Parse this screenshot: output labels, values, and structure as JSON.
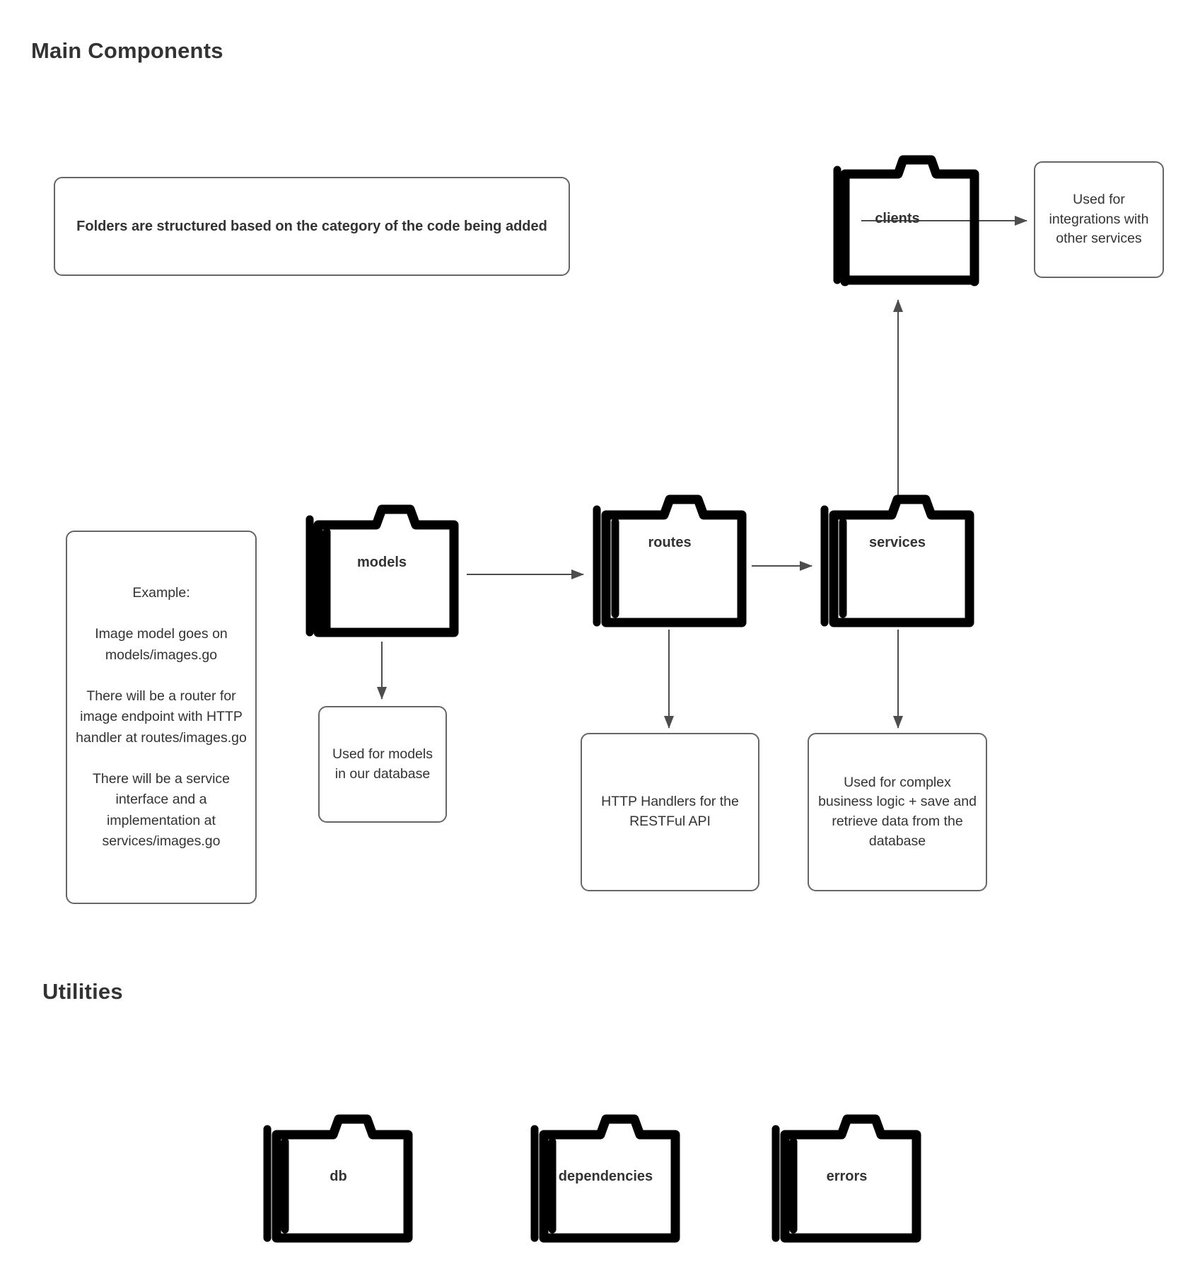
{
  "sections": {
    "main_title": "Main Components",
    "utilities_title": "Utilities"
  },
  "notes": {
    "folder_structure": "Folders are structured based on the category of the code being added",
    "clients_desc": "Used for integrations with other services",
    "example": "Example:\n\nImage model goes on models/images.go\n\nThere will be a router for image endpoint with HTTP handler at routes/images.go\n\nThere will be a service interface and a implementation at services/images.go",
    "models_desc": "Used for models in our database",
    "routes_desc": "HTTP Handlers for the RESTFul API",
    "services_desc": "Used for complex business logic + save and retrieve data from the database"
  },
  "folders": {
    "clients": "clients",
    "models": "models",
    "routes": "routes",
    "services": "services",
    "db": "db",
    "dependencies": "dependencies",
    "errors": "errors"
  },
  "colors": {
    "background": "#ffffff",
    "text": "#333333",
    "note_border": "#666666",
    "folder_stroke": "#000000",
    "arrow": "#4d4d4d"
  }
}
